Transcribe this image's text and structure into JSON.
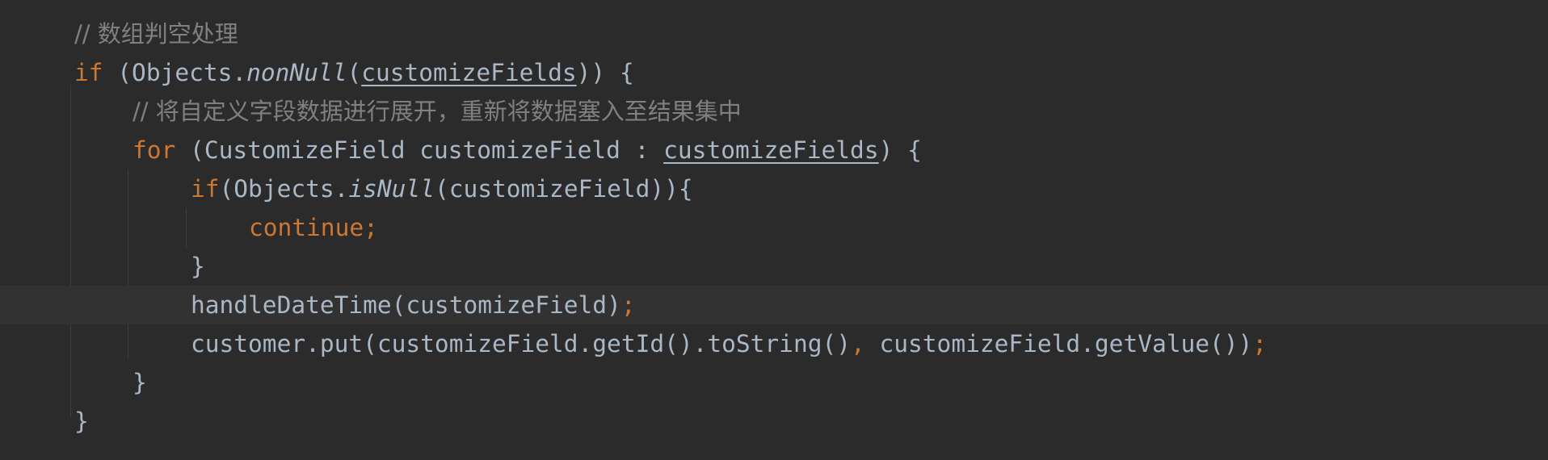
{
  "editor": {
    "language": "java",
    "theme": "darcula",
    "colors": {
      "background": "#2b2b2b",
      "current_line": "#323232",
      "keyword": "#cc7832",
      "identifier": "#a9b7c6",
      "comment": "#808080",
      "indent_guide": "#3c3c3c"
    },
    "lines": {
      "l1": {
        "comment": "// 数组判空处理"
      },
      "l2": {
        "kw_if": "if",
        "open": " (Objects.",
        "method": "nonNull",
        "paren": "(",
        "var": "customizeFields",
        "close": ")) {"
      },
      "l3": {
        "comment": "// 将自定义字段数据进行展开，重新将数据塞入至结果集中"
      },
      "l4": {
        "kw_for": "for",
        "head": " (CustomizeField customizeField : ",
        "var": "customizeFields",
        "close": ") {"
      },
      "l5": {
        "kw_if": "if",
        "open": "(Objects.",
        "method": "isNull",
        "rest": "(customizeField)){"
      },
      "l6": {
        "kw_continue": "continue;"
      },
      "l7": {
        "text": "}"
      },
      "l8": {
        "call": "handleDateTime(customizeField)",
        "semi": ";"
      },
      "l9": {
        "part1": "customer.put(customizeField.getId().toString()",
        "comma": ",",
        "part2": " customizeField.getValue())",
        "semi": ";"
      },
      "l10": {
        "text": "}"
      },
      "l11": {
        "text": "}"
      }
    }
  }
}
